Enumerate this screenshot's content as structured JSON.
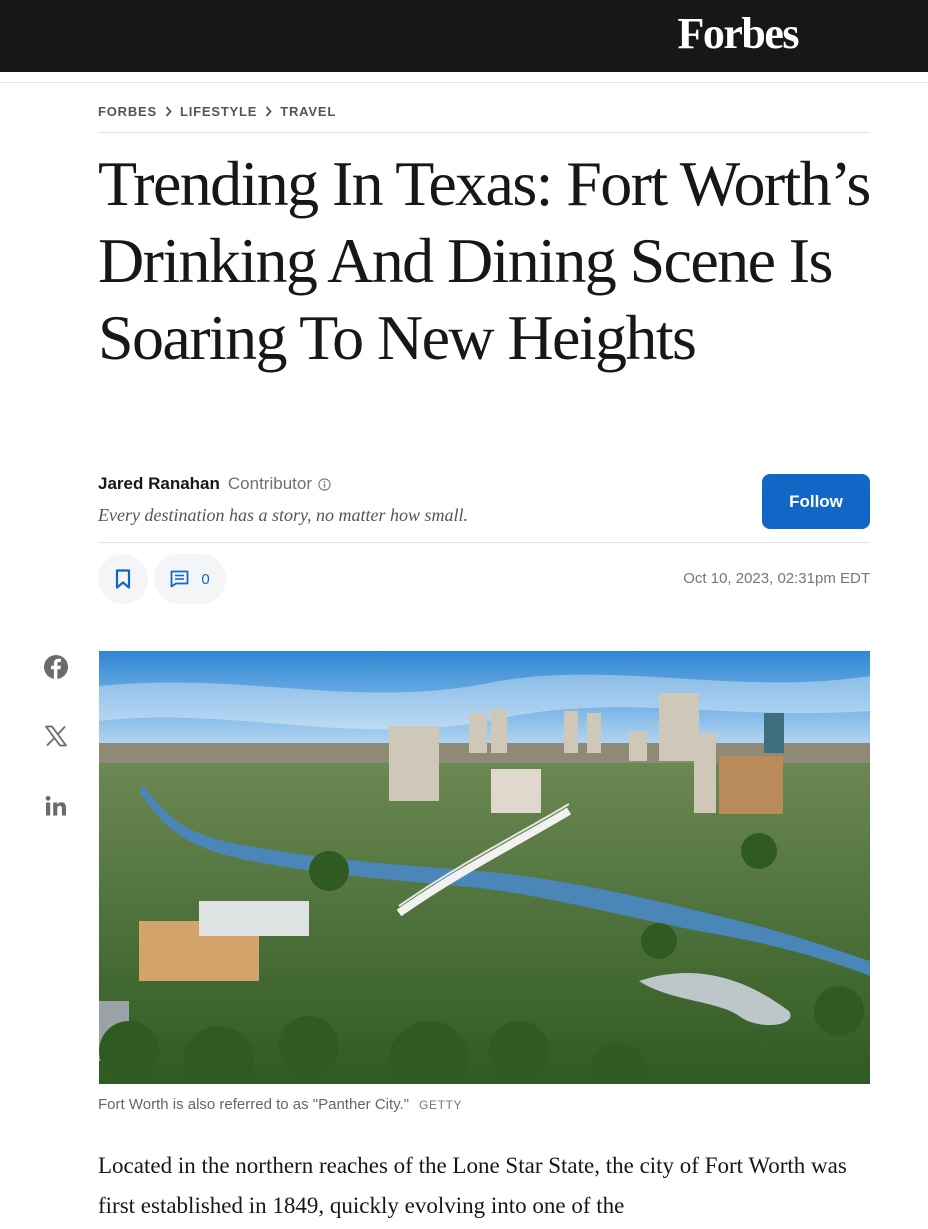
{
  "header": {
    "logo": "Forbes"
  },
  "breadcrumb": {
    "items": [
      "FORBES",
      "LIFESTYLE",
      "TRAVEL"
    ]
  },
  "article": {
    "headline": "Trending In Texas: Fort Worth’s Drinking And Dining Scene Is Soaring To New Heights",
    "author": "Jared Ranahan",
    "author_role": "Contributor",
    "tagline": "Every destination has a story, no matter how small.",
    "follow_label": "Follow",
    "comment_count": "0",
    "timestamp": "Oct 10, 2023, 02:31pm EDT",
    "image_caption": "Fort Worth is also referred to as \"Panther City.\"",
    "image_credit": "GETTY",
    "body_lead": "Located in the northern reaches of the Lone Star State, the city of Fort Worth was first established in 1849, quickly evolving into one of the"
  },
  "share": {
    "icons": [
      "facebook-icon",
      "x-icon",
      "linkedin-icon"
    ]
  },
  "colors": {
    "accent": "#1267c6",
    "topbar": "#181716",
    "text": "#181716",
    "muted": "#6f6f6f"
  }
}
